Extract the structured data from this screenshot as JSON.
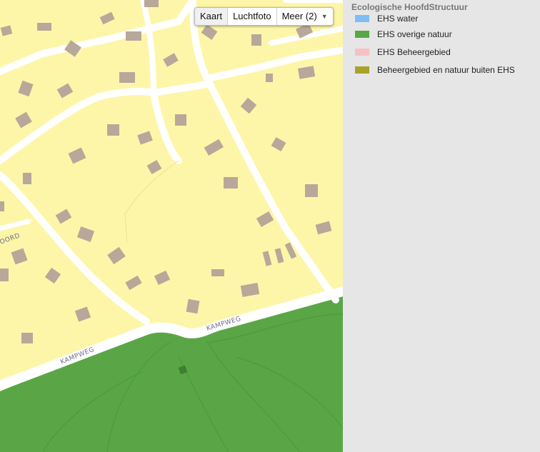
{
  "map": {
    "type_control": {
      "buttons": [
        {
          "label": "Kaart",
          "active": true
        },
        {
          "label": "Luchtfoto",
          "active": false
        },
        {
          "label": "Meer (2)",
          "active": false
        }
      ]
    },
    "road_labels": [
      "KAMPWEG",
      "KAMPWEG",
      "OORD"
    ],
    "colors": {
      "residential": "#fdf6a8",
      "road": "#ffffff",
      "building": "#b8a89a",
      "nature": "#5aa646"
    }
  },
  "legend": {
    "title": "Ecologische HoofdStructuur",
    "items": [
      {
        "label": "EHS water",
        "color": "#7fbdf5"
      },
      {
        "label": "EHS overige natuur",
        "color": "#5aa646"
      },
      {
        "label": "EHS Beheergebied",
        "color": "#f7c1c1"
      },
      {
        "label": "Beheergebied en natuur buiten EHS",
        "color": "#a6a22c"
      }
    ]
  }
}
